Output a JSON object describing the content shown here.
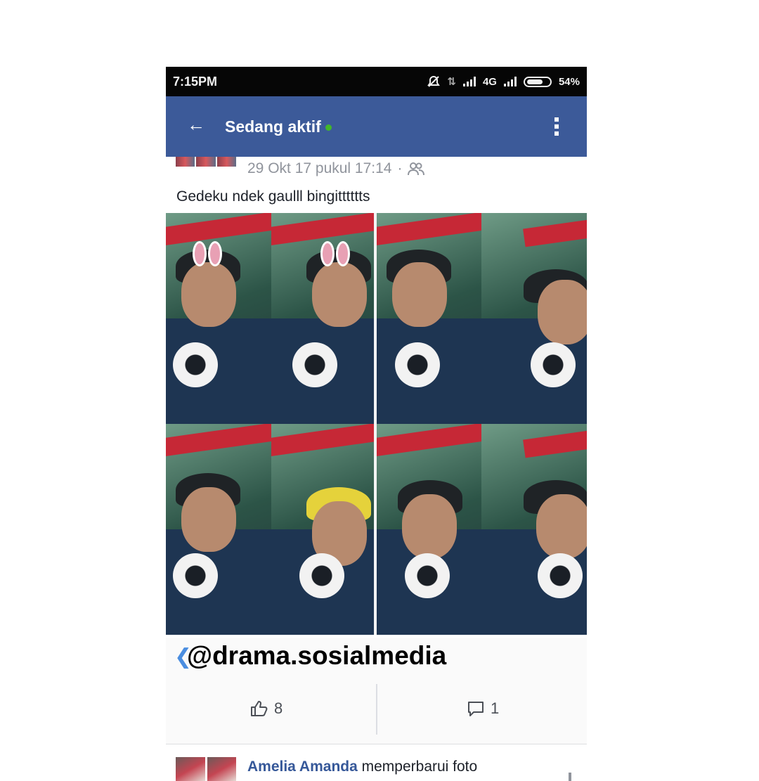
{
  "status_bar": {
    "time": "7:15PM",
    "network": "4G",
    "battery": "54%"
  },
  "header": {
    "title": "Sedang aktif"
  },
  "post": {
    "timestamp": "29 Okt 17 pukul 17:14",
    "separator": "·",
    "text": "Gedeku ndek gaulll bingitttttts",
    "watermark": "@drama.sosialmedia",
    "likes": "8",
    "comments": "1"
  },
  "next_post": {
    "author": "Amelia Amanda",
    "action": "memperbarui foto"
  },
  "colors": {
    "header_bg": "#3c5a99",
    "online_dot": "#42b72a",
    "link": "#365899"
  },
  "icons": [
    "back-arrow-icon",
    "online-dot-icon",
    "more-vert-icon",
    "friends-audience-icon",
    "like-thumb-icon",
    "comment-bubble-icon",
    "silent-icon",
    "signal-icon",
    "battery-icon"
  ]
}
